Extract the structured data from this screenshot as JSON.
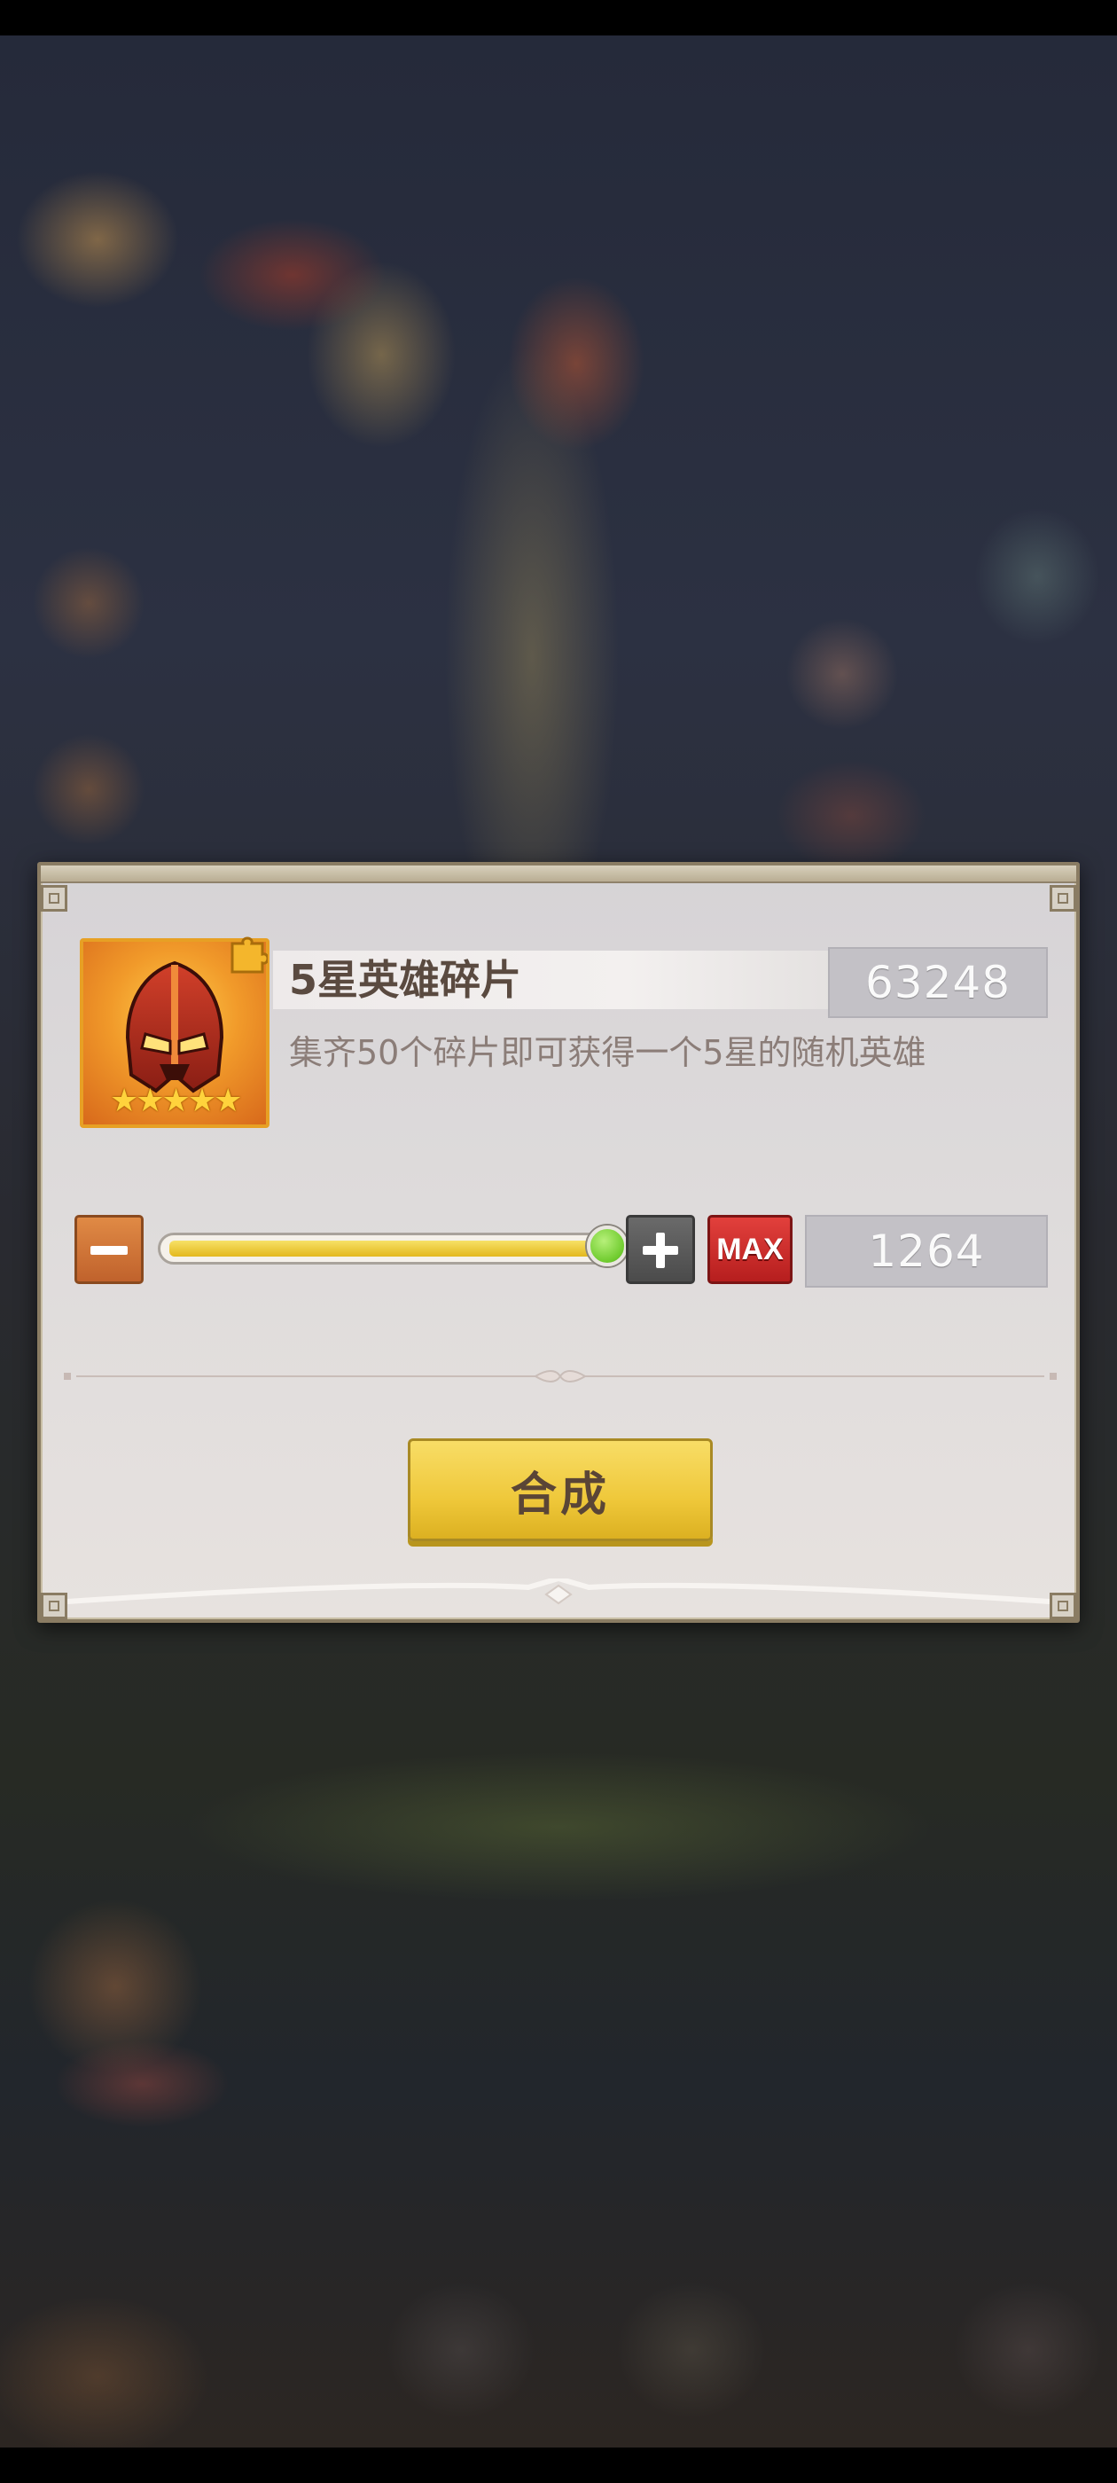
{
  "item": {
    "name": "5星英雄碎片",
    "owned_count": "63248",
    "description": "集齐50个碎片即可获得一个5星的随机英雄",
    "stars": "★★★★★",
    "icon": "helmet-icon",
    "badge_icon": "puzzle-piece-icon"
  },
  "quantity": {
    "value": "1264",
    "slider_fraction": 1.0,
    "max_label": "MAX"
  },
  "actions": {
    "synthesize_label": "合成"
  },
  "colors": {
    "slider_fill": "#e8c12a",
    "knob": "#6fcb2e",
    "max_button": "#c62a28",
    "synthesize_button": "#f0c93c"
  }
}
